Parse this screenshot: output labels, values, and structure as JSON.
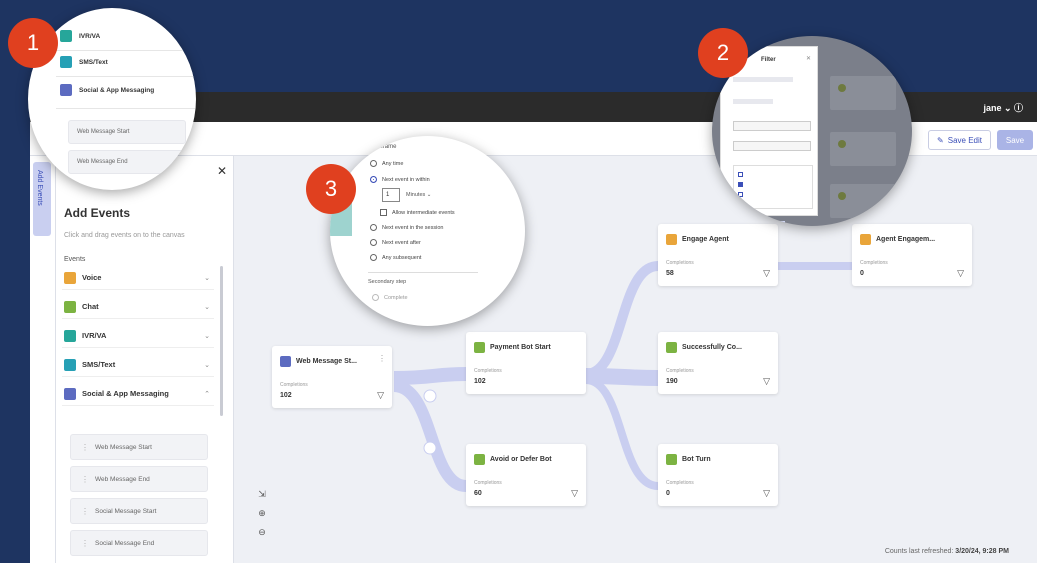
{
  "topbar": {
    "user": "jane ⌄ ⓘ"
  },
  "toolbar": {
    "edit_label": "Save Edit",
    "save_label": "Save"
  },
  "rail": {
    "tab_label": "Add Events"
  },
  "panel": {
    "close": "✕",
    "title": "Add Events",
    "description": "Click and drag events on to the canvas",
    "events_label": "Events",
    "events": [
      {
        "label": "Voice",
        "color": "#e9a53a"
      },
      {
        "label": "Chat",
        "color": "#7cb342"
      },
      {
        "label": "IVR/VA",
        "color": "#26a69a"
      },
      {
        "label": "SMS/Text",
        "color": "#26a0b5"
      },
      {
        "label": "Social & App Messaging",
        "color": "#5c6bc0"
      }
    ],
    "sub_items": [
      "Web Message Start",
      "Web Message End",
      "Social Message Start",
      "Social Message End"
    ]
  },
  "canvas": {
    "zoom_icons": [
      "⇲",
      "⊕",
      "⊖"
    ],
    "refreshed_label": "Counts last refreshed:",
    "refreshed_value": "3/20/24, 9:28 PM"
  },
  "nodes": {
    "web": {
      "title": "Web Message St...",
      "label": "Completions",
      "value": "102",
      "color": "#5c6bc0"
    },
    "payment": {
      "title": "Payment Bot Start",
      "label": "Completions",
      "value": "102",
      "color": "#7cb342"
    },
    "avoid": {
      "title": "Avoid or Defer Bot",
      "label": "Completions",
      "value": "60",
      "color": "#7cb342"
    },
    "engage": {
      "title": "Engage Agent",
      "label": "Completions",
      "value": "58",
      "color": "#e9a53a"
    },
    "success": {
      "title": "Successfully Co...",
      "label": "Completions",
      "value": "190",
      "color": "#7cb342"
    },
    "botturn": {
      "title": "Bot Turn",
      "label": "Completions",
      "value": "0",
      "color": "#7cb342"
    },
    "agent": {
      "title": "Agent Engagem...",
      "label": "Completions",
      "value": "0",
      "color": "#e9a53a"
    }
  },
  "callouts": {
    "one": {
      "badge": "1",
      "rows": [
        {
          "label": "IVR/VA",
          "color": "#26a69a"
        },
        {
          "label": "SMS/Text",
          "color": "#26a0b5"
        },
        {
          "label": "Social & App Messaging",
          "color": "#5c6bc0"
        }
      ],
      "subs": [
        "Web Message Start",
        "Web Message End"
      ]
    },
    "two": {
      "badge": "2",
      "modal_title": "Filter"
    },
    "three": {
      "badge": "3",
      "caption": "Timeframe",
      "options": [
        "Any time",
        "Next event in within",
        "Next event in the session",
        "Next event after",
        "Next event after",
        "Any subsequent"
      ],
      "number": "1",
      "minutes": "Minutes ⌄",
      "checkbox": "Allow intermediate events",
      "section": "Secondary step",
      "section_value": "Complete"
    }
  },
  "colors": {
    "accent": "#3b4fb8",
    "badge": "#e0401f",
    "flow": "#c9cef0"
  }
}
